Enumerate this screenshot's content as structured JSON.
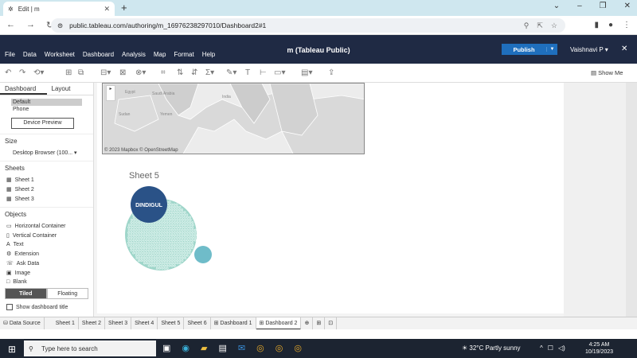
{
  "browser": {
    "tab_title": "Edit | m",
    "url": "public.tableau.com/authoring/m_16976238297010/Dashboard2#1"
  },
  "app": {
    "title": "m (Tableau Public)",
    "menu": [
      "File",
      "Data",
      "Worksheet",
      "Dashboard",
      "Analysis",
      "Map",
      "Format",
      "Help"
    ],
    "publish_label": "Publish",
    "user": "Vaishnavi P",
    "show_me": "Show Me"
  },
  "left_panel": {
    "tabs": [
      "Dashboard",
      "Layout"
    ],
    "devices": [
      "Default",
      "Phone"
    ],
    "device_preview": "Device Preview",
    "size_title": "Size",
    "size_value": "Desktop Browser (100...",
    "sheets_title": "Sheets",
    "sheets": [
      "Sheet 1",
      "Sheet 2",
      "Sheet 3"
    ],
    "objects_title": "Objects",
    "objects": [
      "Horizontal Container",
      "Vertical Container",
      "Text",
      "Extension",
      "Ask Data",
      "Image",
      "Blank"
    ],
    "tiled": "Tiled",
    "floating": "Floating",
    "show_title": "Show dashboard title"
  },
  "map": {
    "labels": [
      "Egypt",
      "Saudi Arabia",
      "Sudan",
      "Yemen",
      "India"
    ],
    "attribution": "© 2023 Mapbox © OpenStreetMap"
  },
  "sheet5": {
    "title": "Sheet 5",
    "bubble_label": "DINDIGUL"
  },
  "sheet_tabs": [
    "Data Source",
    "Sheet 1",
    "Sheet 2",
    "Sheet 3",
    "Sheet 4",
    "Sheet 5",
    "Sheet 6",
    "Dashboard 1",
    "Dashboard 2"
  ],
  "taskbar": {
    "search_placeholder": "Type here to search",
    "weather": "32°C  Partly sunny",
    "time": "4:25 AM",
    "date": "10/19/2023"
  },
  "colors": {
    "header_bg": "#1f2a44",
    "publish": "#1f6fbd",
    "bubble_main": "#2a5287",
    "bubble_cluster": "#9fd6ca",
    "bubble_small": "#6fbcc9"
  }
}
